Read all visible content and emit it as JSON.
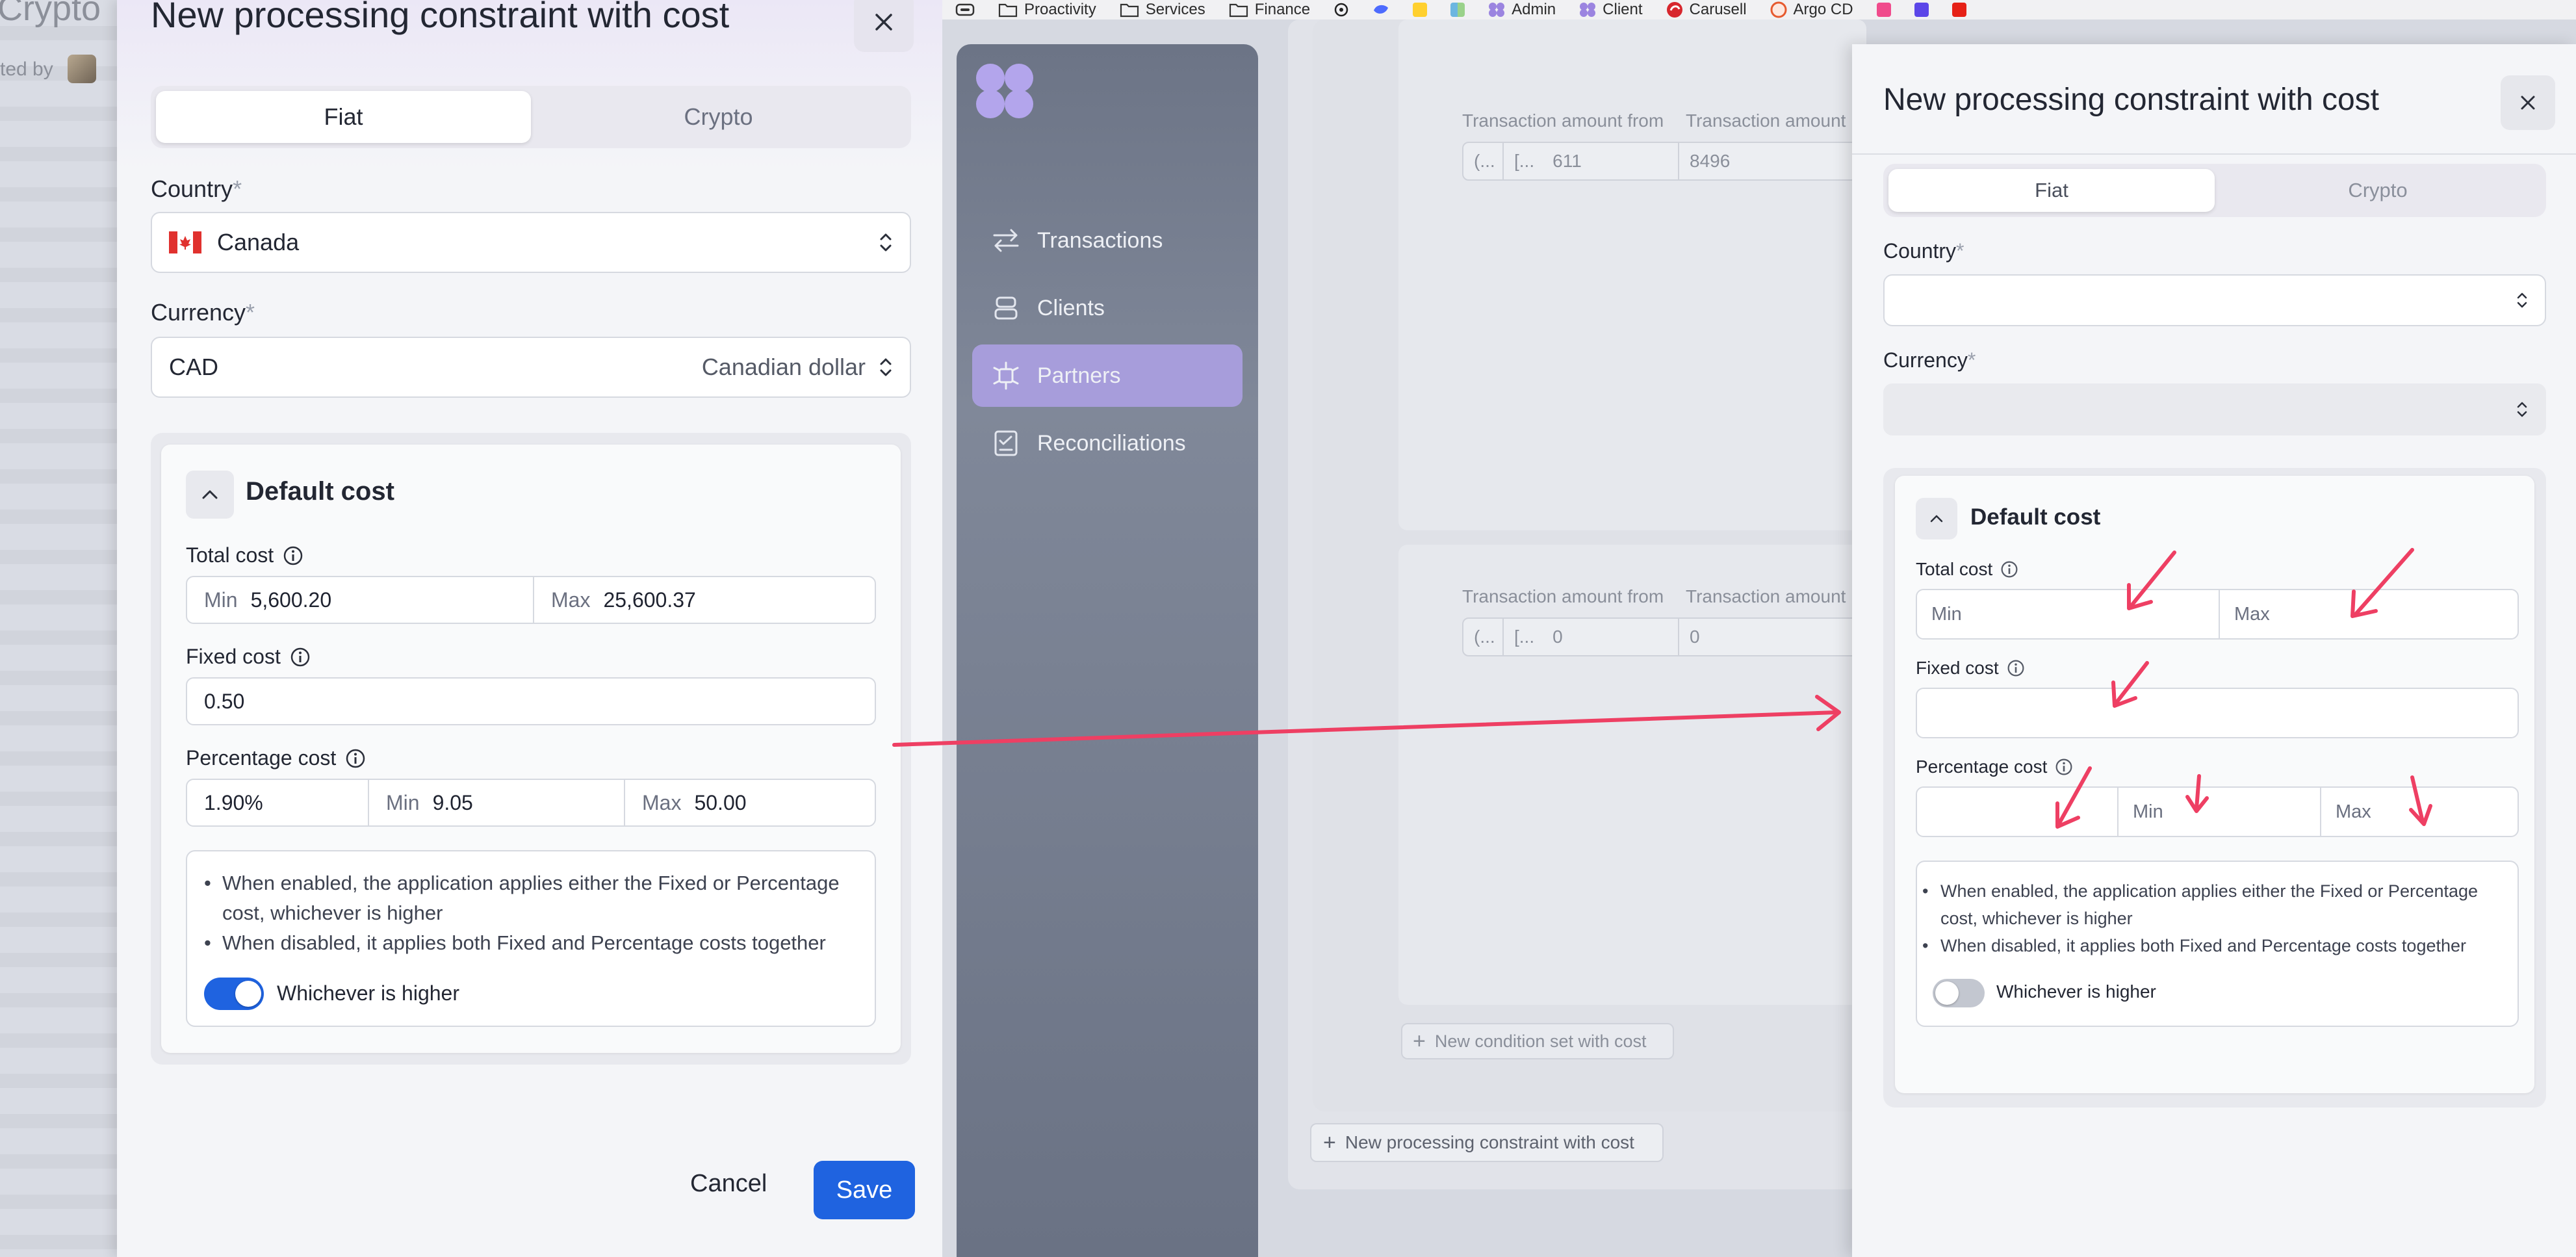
{
  "background": {
    "crypto_label": "Crypto",
    "created_by": "ted by"
  },
  "left_modal": {
    "title": "New processing constraint with cost",
    "tabs": [
      "Fiat",
      "Crypto"
    ],
    "country": {
      "label": "Country",
      "required": "*",
      "value": "Canada",
      "flag": "canada-flag-icon"
    },
    "currency": {
      "label": "Currency",
      "required": "*",
      "code": "CAD",
      "name": "Canadian dollar"
    },
    "default_cost": {
      "title": "Default cost",
      "total_cost": {
        "label": "Total cost",
        "min_label": "Min",
        "min_value": "5,600.20",
        "max_label": "Max",
        "max_value": "25,600.37"
      },
      "fixed_cost": {
        "label": "Fixed cost",
        "value": "0.50"
      },
      "percentage_cost": {
        "label": "Percentage cost",
        "value": "1.90%",
        "min_label": "Min",
        "min_value": "9.05",
        "max_label": "Max",
        "max_value": "50.00"
      },
      "notes": [
        "When enabled, the application applies either the Fixed or Percentage cost, whichever is higher",
        "When disabled, it applies both Fixed and Percentage costs together"
      ],
      "toggle_label": "Whichever is higher",
      "toggle_on": true
    },
    "cancel_label": "Cancel",
    "save_label": "Save",
    "accent": "#1f63e0"
  },
  "bookmarks": [
    {
      "label": "Proactivity",
      "icon": "folder-icon"
    },
    {
      "label": "Services",
      "icon": "folder-icon"
    },
    {
      "label": "Finance",
      "icon": "folder-icon"
    },
    {
      "label": "",
      "icon": "openai-icon"
    },
    {
      "label": "",
      "icon": "deepseek-icon"
    },
    {
      "label": "",
      "icon": "miro-icon"
    },
    {
      "label": "",
      "icon": "map-icon"
    },
    {
      "label": "Admin",
      "icon": "app-logo-icon"
    },
    {
      "label": "Client",
      "icon": "app-logo-icon"
    },
    {
      "label": "Carusell",
      "icon": "carusell-icon"
    },
    {
      "label": "Argo CD",
      "icon": "argo-icon"
    },
    {
      "label": "",
      "icon": "s-pink-icon"
    },
    {
      "label": "",
      "icon": "s-blue-icon"
    },
    {
      "label": "",
      "icon": "youtube-icon"
    }
  ],
  "sidebar": {
    "items": [
      {
        "label": "Transactions",
        "icon": "transactions-icon",
        "active": false
      },
      {
        "label": "Clients",
        "icon": "clients-icon",
        "active": false
      },
      {
        "label": "Partners",
        "icon": "partners-icon",
        "active": true
      },
      {
        "label": "Reconciliations",
        "icon": "reconciliations-icon",
        "active": false
      }
    ]
  },
  "background_page": {
    "amount_from_label": "Transaction amount from",
    "amount_to_label": "Transaction amount",
    "row1": {
      "a": "(...",
      "b": "[...",
      "from": "611",
      "to": "8496"
    },
    "row2": {
      "a": "(...",
      "b": "[...",
      "from": "0",
      "to": "0"
    },
    "new_condition_set": "New condition set with cost",
    "new_constraint": "New processing constraint with cost"
  },
  "right_modal": {
    "title": "New processing constraint with cost",
    "tabs": [
      "Fiat",
      "Crypto"
    ],
    "country_label": "Country",
    "currency_label": "Currency",
    "required": "*",
    "default_cost": {
      "title": "Default cost",
      "total_cost_label": "Total cost",
      "min_placeholder": "Min",
      "max_placeholder": "Max",
      "fixed_cost_label": "Fixed cost",
      "percentage_cost_label": "Percentage cost",
      "notes": [
        "When enabled, the application applies either the Fixed or Percentage cost, whichever is higher",
        "When disabled, it applies both Fixed and Percentage costs together"
      ],
      "toggle_label": "Whichever is higher",
      "toggle_on": false
    }
  },
  "annotation_color": "#ee3f63"
}
